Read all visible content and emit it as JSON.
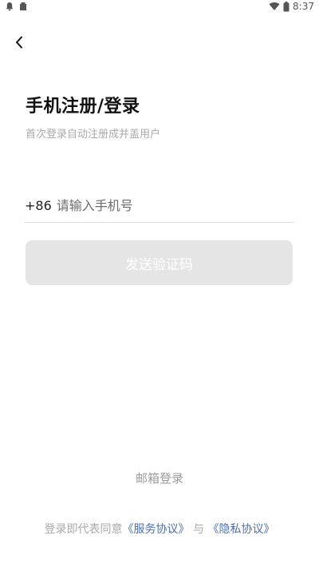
{
  "status_bar": {
    "time": "8:37",
    "icons": [
      "notification-bell-icon",
      "notification-app-icon",
      "wifi-icon",
      "battery-icon"
    ]
  },
  "header": {
    "back_icon": "chevron-left-icon"
  },
  "form": {
    "title": "手机注册/登录",
    "subtitle": "首次登录自动注册成并盖用户",
    "country_code": "+86",
    "phone_placeholder": "请输入手机号",
    "phone_value": "",
    "send_code_label": "发送验证码"
  },
  "footer": {
    "email_login_label": "邮箱登录",
    "agreement_prefix": "登录即代表同意",
    "service_agreement_link": "《服务协议》",
    "agreement_joiner": "与",
    "privacy_agreement_link": "《隐私协议》"
  },
  "colors": {
    "accent_link": "#4a6fb5",
    "button_disabled_bg": "#e5e5e5",
    "muted_text": "#a9a9a9"
  }
}
